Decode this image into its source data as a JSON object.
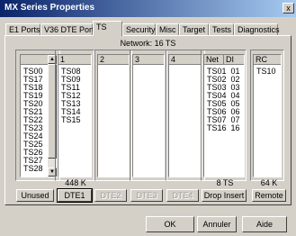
{
  "window": {
    "title": "MX Series Properties",
    "close_label": "x"
  },
  "tabs": [
    {
      "label": "E1 Ports"
    },
    {
      "label": "V36 DTE Port"
    },
    {
      "label": "TS"
    },
    {
      "label": "Security"
    },
    {
      "label": "Misc"
    },
    {
      "label": "Target"
    },
    {
      "label": "Tests"
    },
    {
      "label": "Diagnostics"
    }
  ],
  "active_tab": "TS",
  "network_label": "Network: 16 TS",
  "unused": {
    "items": [
      "TS00",
      "TS17",
      "TS18",
      "TS19",
      "TS20",
      "TS21",
      "TS22",
      "TS23",
      "TS24",
      "TS25",
      "TS26",
      "TS27",
      "TS28"
    ],
    "button": "Unused"
  },
  "dte": [
    {
      "header": "1",
      "items": [
        "TS08",
        "TS09",
        "TS11",
        "TS12",
        "TS13",
        "TS14",
        "TS15"
      ],
      "count": "448 K",
      "button": "DTE1",
      "enabled": true
    },
    {
      "header": "2",
      "items": [],
      "count": "",
      "button": "DTE2",
      "enabled": false
    },
    {
      "header": "3",
      "items": [],
      "count": "",
      "button": "DTE3",
      "enabled": false
    },
    {
      "header": "4",
      "items": [],
      "count": "",
      "button": "DTE4",
      "enabled": false
    }
  ],
  "net": {
    "header_net": "Net",
    "header_di": "DI",
    "rows": [
      {
        "net": "TS01",
        "di": "01"
      },
      {
        "net": "TS02",
        "di": "02"
      },
      {
        "net": "TS03",
        "di": "03"
      },
      {
        "net": "TS04",
        "di": "04"
      },
      {
        "net": "TS05",
        "di": "05"
      },
      {
        "net": "TS06",
        "di": "06"
      },
      {
        "net": "TS07",
        "di": "07"
      },
      {
        "net": "TS16",
        "di": "16"
      }
    ],
    "count": "8 TS",
    "button": "Drop Insert"
  },
  "rc": {
    "header": "RC",
    "items": [
      "TS10"
    ],
    "count": "64 K",
    "button": "Remote"
  },
  "footer": {
    "ok": "OK",
    "cancel": "Annuler",
    "help": "Aide"
  }
}
